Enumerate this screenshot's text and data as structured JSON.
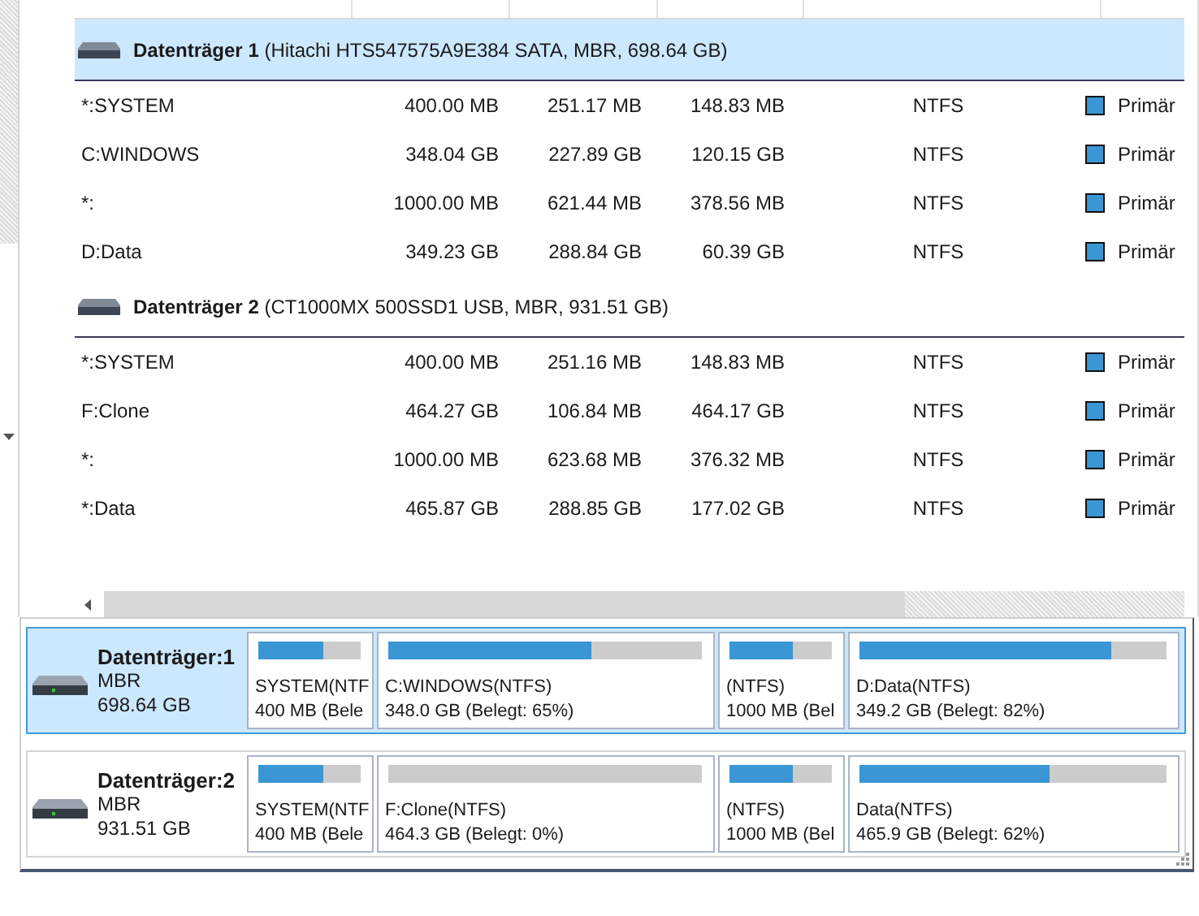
{
  "disks": [
    {
      "header": "**Datenträger 1** (Hitachi HTS547575A9E384 SATA, MBR, 698.64 GB)",
      "selected": true,
      "partitions": [
        {
          "name": "*:SYSTEM",
          "capacity": "400.00 MB",
          "used": "251.17 MB",
          "free": "148.83 MB",
          "fs": "NTFS",
          "type": "Primär"
        },
        {
          "name": "C:WINDOWS",
          "capacity": "348.04 GB",
          "used": "227.89 GB",
          "free": "120.15 GB",
          "fs": "NTFS",
          "type": "Primär"
        },
        {
          "name": "*:",
          "capacity": "1000.00 MB",
          "used": "621.44 MB",
          "free": "378.56 MB",
          "fs": "NTFS",
          "type": "Primär"
        },
        {
          "name": "D:Data",
          "capacity": "349.23 GB",
          "used": "288.84 GB",
          "free": "60.39 GB",
          "fs": "NTFS",
          "type": "Primär"
        }
      ]
    },
    {
      "header": "**Datenträger 2** (CT1000MX 500SSD1 USB, MBR, 931.51 GB)",
      "selected": false,
      "partitions": [
        {
          "name": "*:SYSTEM",
          "capacity": "400.00 MB",
          "used": "251.16 MB",
          "free": "148.83 MB",
          "fs": "NTFS",
          "type": "Primär"
        },
        {
          "name": "F:Clone",
          "capacity": "464.27 GB",
          "used": "106.84 MB",
          "free": "464.17 GB",
          "fs": "NTFS",
          "type": "Primär"
        },
        {
          "name": "*:",
          "capacity": "1000.00 MB",
          "used": "623.68 MB",
          "free": "376.32 MB",
          "fs": "NTFS",
          "type": "Primär"
        },
        {
          "name": "*:Data",
          "capacity": "465.87 GB",
          "used": "288.85 GB",
          "free": "177.02 GB",
          "fs": "NTFS",
          "type": "Primär"
        }
      ]
    }
  ],
  "disk_map": [
    {
      "name": "Datenträger:1",
      "scheme": "MBR",
      "size": "698.64 GB",
      "selected": true,
      "partitions": [
        {
          "label": "SYSTEM(NTF",
          "detail": "400 MB (Bele",
          "level": 0.63
        },
        {
          "label": "C:WINDOWS(NTFS)",
          "detail": "348.0 GB (Belegt: 65%)",
          "level": 0.65
        },
        {
          "label": "(NTFS)",
          "detail": "1000 MB (Bel",
          "level": 0.62
        },
        {
          "label": "D:Data(NTFS)",
          "detail": "349.2 GB (Belegt: 82%)",
          "level": 0.82
        }
      ]
    },
    {
      "name": "Datenträger:2",
      "scheme": "MBR",
      "size": "931.51 GB",
      "selected": false,
      "partitions": [
        {
          "label": "SYSTEM(NTF",
          "detail": "400 MB (Bele",
          "level": 0.63
        },
        {
          "label": "F:Clone(NTFS)",
          "detail": "464.3 GB (Belegt: 0%)",
          "level": 0
        },
        {
          "label": "(NTFS)",
          "detail": "1000 MB (Bel",
          "level": 0.62
        },
        {
          "label": "Data(NTFS)",
          "detail": "465.9 GB (Belegt: 62%)",
          "level": 0.62
        }
      ]
    }
  ]
}
